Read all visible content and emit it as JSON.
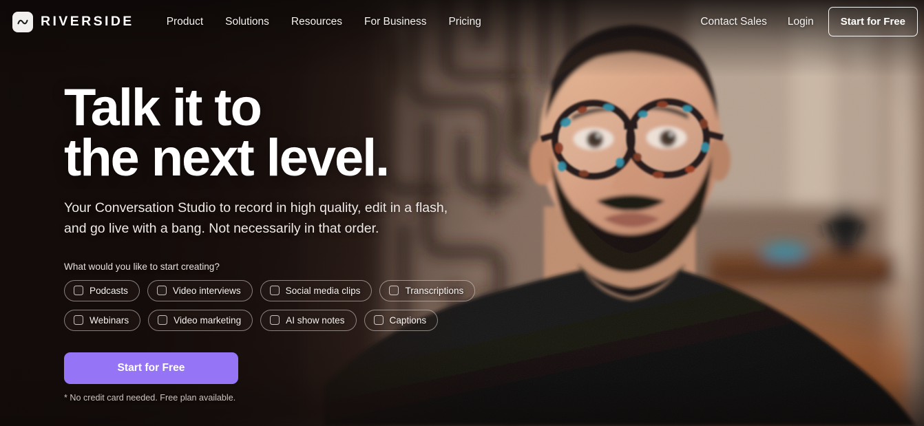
{
  "brand": {
    "name": "RIVERSIDE",
    "logo_icon": "waveform-icon"
  },
  "nav": {
    "links": [
      {
        "label": "Product"
      },
      {
        "label": "Solutions"
      },
      {
        "label": "Resources"
      },
      {
        "label": "For Business"
      },
      {
        "label": "Pricing"
      }
    ],
    "contact_sales": "Contact Sales",
    "login": "Login",
    "cta": "Start for Free"
  },
  "hero": {
    "headline": "Talk it to\nthe next level.",
    "subhead": "Your Conversation Studio to record in high quality, edit in a flash,\nand go live with a bang. Not necessarily in that order.",
    "prompt": "What would you like to start creating?",
    "cta": "Start for Free",
    "fineprint": "* No credit card needed. Free plan available."
  },
  "chips": {
    "row1": [
      {
        "label": "Podcasts",
        "checked": false
      },
      {
        "label": "Video interviews",
        "checked": false
      },
      {
        "label": "Social media clips",
        "checked": false
      },
      {
        "label": "Transcriptions",
        "checked": false
      }
    ],
    "row2": [
      {
        "label": "Webinars",
        "checked": false
      },
      {
        "label": "Video marketing",
        "checked": false
      },
      {
        "label": "AI show notes",
        "checked": false
      },
      {
        "label": "Captions",
        "checked": false
      }
    ]
  },
  "colors": {
    "accent_purple": "#9575f5",
    "page_dark": "#120d0b",
    "nav_text": "#f4f2f1",
    "warm_glow": "#d9722f"
  },
  "background": {
    "description": "Blurred photo of a bearded man wearing tortoiseshell glasses and a black crew-neck shirt, seated in front of an out-of-focus maze-patterned wall with a wooden shelf and warm orange lamp glow on the right"
  }
}
